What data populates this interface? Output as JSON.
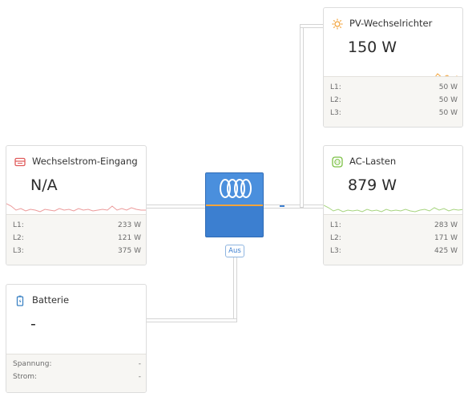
{
  "colors": {
    "grid": "#e05a5a",
    "solar": "#f3a43b",
    "ac": "#7bc043",
    "battery": "#3b82c4",
    "inverter": "#3c7fd0"
  },
  "pv": {
    "title": "PV-Wechselrichter",
    "icon": "sun-icon",
    "value": "150 W",
    "rows": [
      {
        "label": "L1:",
        "value": "50 W"
      },
      {
        "label": "L2:",
        "value": "50 W"
      },
      {
        "label": "L3:",
        "value": "50 W"
      }
    ]
  },
  "grid_input": {
    "title": "Wechselstrom-Eingang",
    "icon": "grid-icon",
    "value": "N/A",
    "rows": [
      {
        "label": "L1:",
        "value": "233 W"
      },
      {
        "label": "L2:",
        "value": "121 W"
      },
      {
        "label": "L3:",
        "value": "375 W"
      }
    ]
  },
  "ac_loads": {
    "title": "AC-Lasten",
    "icon": "outlet-icon",
    "value": "879 W",
    "rows": [
      {
        "label": "L1:",
        "value": "283 W"
      },
      {
        "label": "L2:",
        "value": "171 W"
      },
      {
        "label": "L3:",
        "value": "425 W"
      }
    ]
  },
  "battery": {
    "title": "Batterie",
    "icon": "battery-icon",
    "value": "-",
    "rows": [
      {
        "label": "Spannung:",
        "value": "-"
      },
      {
        "label": "Strom:",
        "value": "-"
      }
    ]
  },
  "inverter": {
    "mode_label": "Aus",
    "icon": "victron-logo"
  }
}
